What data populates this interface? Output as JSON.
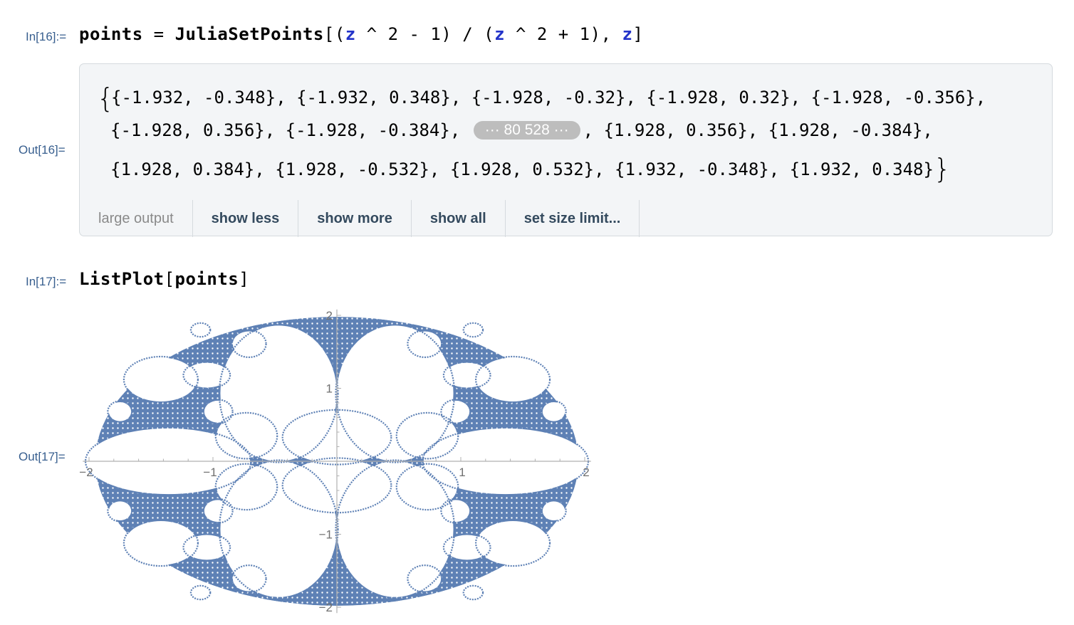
{
  "cells": [
    {
      "in_label": "In[16]:=",
      "out_label": "Out[16]=",
      "input": {
        "lhs": "points",
        "eq": " = ",
        "func": "JuliaSetPoints",
        "open": "[",
        "p1": "(",
        "z1": "z",
        "e1": " ^ 2 - 1",
        "p2": ")",
        "slash": " / ",
        "p3": "(",
        "z2": "z",
        "e2": " ^ 2 + 1",
        "p4": ")",
        "comma": ", ",
        "z3": "z",
        "close": "]"
      },
      "output": {
        "open_brace": "{",
        "close_brace": "}",
        "line1": "{-1.932, -0.348}, {-1.932, 0.348}, {-1.928, -0.32}, {-1.928, 0.32}, {-1.928, -0.356},",
        "line2_before": "{-1.928, 0.356}, {-1.928, -0.384}, ",
        "elided": "··· 80 528 ···",
        "line2_after": ", {1.928, 0.356}, {1.928, -0.384},",
        "line3": "{1.928, 0.384}, {1.928, -0.532}, {1.928, 0.532}, {1.932, -0.348}, {1.932, 0.348}"
      },
      "toolbar": {
        "large_output": "large output",
        "show_less": "show less",
        "show_more": "show more",
        "show_all": "show all",
        "set_size_limit": "set size limit..."
      }
    },
    {
      "in_label": "In[17]:=",
      "out_label": "Out[17]=",
      "input": {
        "func": "ListPlot",
        "open": "[",
        "arg": "points",
        "close": "]"
      }
    }
  ],
  "chart_data": {
    "type": "scatter",
    "description_source": "Julia set of (z^2-1)/(z^2+1); points fill an elliptical fractal region",
    "point_color": "#5e81b5",
    "xlim": [
      -2,
      2
    ],
    "ylim": [
      -2,
      2
    ],
    "x_ticks": [
      "-2",
      "-1",
      "1",
      "2"
    ],
    "y_ticks": [
      "2",
      "1",
      "-1",
      "-2"
    ],
    "x_tick_values": [
      -2,
      -1,
      1,
      2
    ],
    "y_tick_values": [
      2,
      1,
      -1,
      -2
    ],
    "grid": false,
    "holes": [
      [
        0.47,
        0.93,
        0.47,
        0.93
      ],
      [
        -0.47,
        0.93,
        0.47,
        0.93
      ],
      [
        0.47,
        -0.93,
        0.47,
        0.93
      ],
      [
        -0.47,
        -0.93,
        0.47,
        0.93
      ],
      [
        1.36,
        0.0,
        0.66,
        0.45
      ],
      [
        -1.36,
        0.0,
        0.66,
        0.45
      ],
      [
        0.0,
        0.33,
        0.43,
        0.36
      ],
      [
        0.0,
        -0.33,
        0.43,
        0.36
      ],
      [
        0.73,
        0.35,
        0.24,
        0.3
      ],
      [
        -0.73,
        0.35,
        0.24,
        0.3
      ],
      [
        0.73,
        -0.35,
        0.24,
        0.3
      ],
      [
        -0.73,
        -0.35,
        0.24,
        0.3
      ],
      [
        1.42,
        1.12,
        0.29,
        0.3
      ],
      [
        -1.42,
        1.12,
        0.29,
        0.3
      ],
      [
        1.42,
        -1.12,
        0.29,
        0.3
      ],
      [
        -1.42,
        -1.12,
        0.29,
        0.3
      ],
      [
        1.05,
        1.18,
        0.18,
        0.17
      ],
      [
        -1.05,
        1.18,
        0.18,
        0.17
      ],
      [
        1.05,
        -1.18,
        0.18,
        0.17
      ],
      [
        -1.05,
        -1.18,
        0.18,
        0.17
      ],
      [
        0.71,
        1.61,
        0.13,
        0.17
      ],
      [
        -0.71,
        1.61,
        0.13,
        0.17
      ],
      [
        0.71,
        -1.61,
        0.13,
        0.17
      ],
      [
        -0.71,
        -1.61,
        0.13,
        0.17
      ],
      [
        0.96,
        0.68,
        0.11,
        0.15
      ],
      [
        -0.96,
        0.68,
        0.11,
        0.15
      ],
      [
        0.96,
        -0.68,
        0.11,
        0.15
      ],
      [
        -0.96,
        -0.68,
        0.11,
        0.15
      ],
      [
        1.75,
        0.68,
        0.09,
        0.13
      ],
      [
        -1.75,
        0.68,
        0.09,
        0.13
      ],
      [
        1.75,
        -0.68,
        0.09,
        0.13
      ],
      [
        -1.75,
        -0.68,
        0.09,
        0.13
      ],
      [
        1.1,
        1.8,
        0.07,
        0.08
      ],
      [
        -1.1,
        1.8,
        0.07,
        0.08
      ],
      [
        1.1,
        -1.8,
        0.07,
        0.08
      ],
      [
        -1.1,
        -1.8,
        0.07,
        0.08
      ]
    ]
  }
}
